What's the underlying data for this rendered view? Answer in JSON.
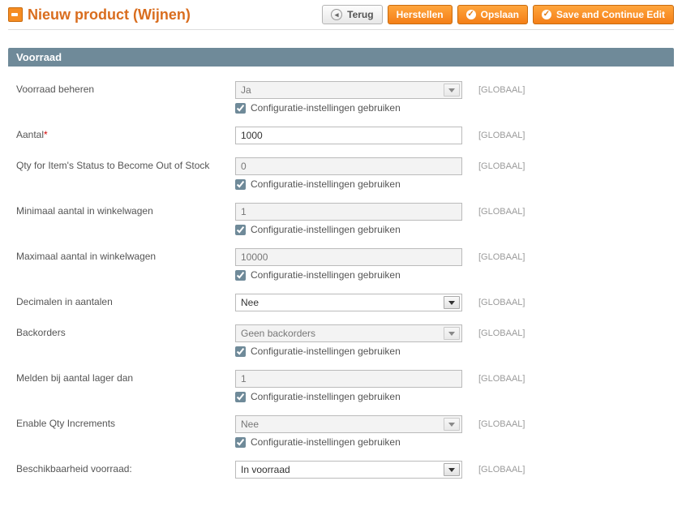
{
  "header": {
    "title": "Nieuw product (Wijnen)",
    "buttons": {
      "back": "Terug",
      "reset": "Herstellen",
      "save": "Opslaan",
      "save_continue": "Save and Continue Edit"
    }
  },
  "section": {
    "title": "Voorraad",
    "scope_label": "[GLOBAAL]",
    "config_label": "Configuratie-instellingen gebruiken",
    "fields": {
      "manage_stock": {
        "label": "Voorraad beheren",
        "value": "Ja",
        "disabled": true,
        "use_config": true
      },
      "qty": {
        "label": "Aantal",
        "required": true,
        "value": "1000"
      },
      "min_qty": {
        "label": "Qty for Item's Status to Become Out of Stock",
        "value": "0",
        "disabled": true,
        "use_config": true
      },
      "min_sale": {
        "label": "Minimaal aantal in winkelwagen",
        "value": "1",
        "disabled": true,
        "use_config": true
      },
      "max_sale": {
        "label": "Maximaal aantal in winkelwagen",
        "value": "10000",
        "disabled": true,
        "use_config": true
      },
      "decimal": {
        "label": "Decimalen in aantalen",
        "value": "Nee"
      },
      "backorders": {
        "label": "Backorders",
        "value": "Geen backorders",
        "disabled": true,
        "use_config": true
      },
      "notify": {
        "label": "Melden bij aantal lager dan",
        "value": "1",
        "disabled": true,
        "use_config": true
      },
      "qty_inc": {
        "label": "Enable Qty Increments",
        "value": "Nee",
        "disabled": true,
        "use_config": true
      },
      "availability": {
        "label": "Beschikbaarheid voorraad:",
        "value": "In voorraad"
      }
    }
  }
}
